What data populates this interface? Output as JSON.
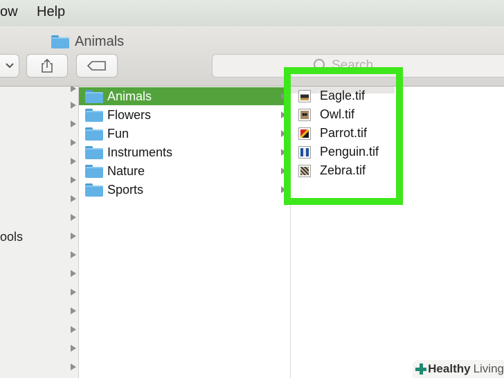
{
  "menubar": {
    "items": [
      {
        "label": "ow"
      },
      {
        "label": "Help"
      }
    ]
  },
  "window": {
    "title": "Animals"
  },
  "search": {
    "placeholder": "Search"
  },
  "sidebar": {
    "partial_label": "ools"
  },
  "column1": {
    "items": [
      {
        "label": "Animals",
        "selected": true
      },
      {
        "label": "Flowers"
      },
      {
        "label": "Fun"
      },
      {
        "label": "Instruments"
      },
      {
        "label": "Nature"
      },
      {
        "label": "Sports"
      }
    ]
  },
  "column2": {
    "files": [
      {
        "label": "Eagle.tif",
        "thumb_icon": "eagle-thumbnail-icon"
      },
      {
        "label": "Owl.tif",
        "thumb_icon": "owl-thumbnail-icon"
      },
      {
        "label": "Parrot.tif",
        "thumb_icon": "parrot-thumbnail-icon"
      },
      {
        "label": "Penguin.tif",
        "thumb_icon": "penguin-thumbnail-icon"
      },
      {
        "label": "Zebra.tif",
        "thumb_icon": "zebra-thumbnail-icon"
      }
    ]
  },
  "watermark": {
    "brand": "Healthy",
    "suffix": "Living"
  },
  "colors": {
    "selection": "#53a33c",
    "highlight": "#3ee71b",
    "folder": "#62b2e6"
  }
}
